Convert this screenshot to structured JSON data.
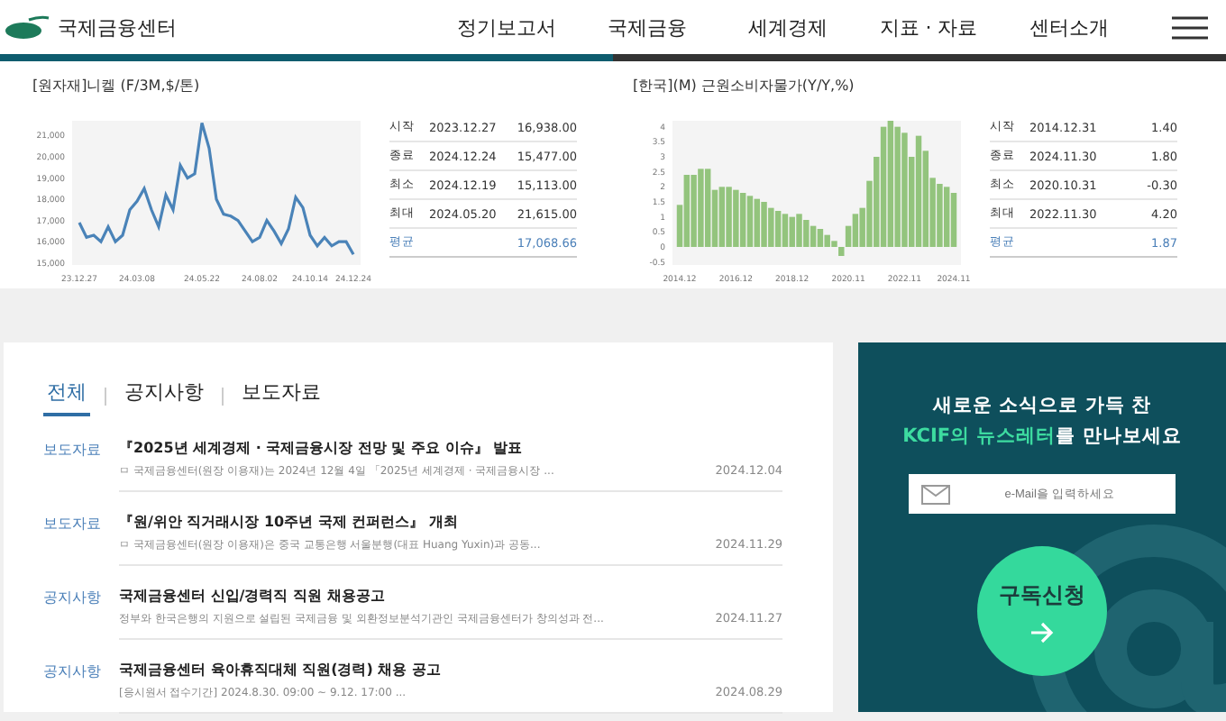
{
  "header": {
    "logo_text": "국제금융센터",
    "nav": [
      "정기보고서",
      "국제금융",
      "세계경제",
      "지표 · 자료",
      "센터소개"
    ]
  },
  "indicators": [
    {
      "title": "[원자재]니켈 (F/3M,$/톤)",
      "chart_data": {
        "type": "line",
        "categories": [
          "23.12.27",
          null,
          null,
          null,
          null,
          null,
          null,
          null,
          "24.03.08",
          null,
          null,
          null,
          null,
          null,
          null,
          null,
          null,
          "24.05.22",
          null,
          null,
          null,
          null,
          null,
          null,
          null,
          "24.08.02",
          null,
          null,
          null,
          null,
          null,
          null,
          "24.10.14",
          null,
          null,
          null,
          null,
          null,
          "24.12.24"
        ],
        "series": [
          {
            "color": "#4a83b8",
            "values": [
              16900,
              16200,
              16300,
              16000,
              16700,
              16000,
              16300,
              17500,
              17900,
              18500,
              17500,
              16700,
              18200,
              17500,
              19600,
              19000,
              19200,
              21600,
              20400,
              18000,
              17300,
              17200,
              17000,
              16500,
              16000,
              16200,
              17000,
              16500,
              15900,
              16600,
              18100,
              17600,
              16300,
              15800,
              16200,
              15800,
              16000,
              16000,
              15400
            ]
          }
        ],
        "ylim": [
          14900,
          21700
        ],
        "yticks": [
          {
            "value": 15000,
            "label": "15,000"
          },
          {
            "value": 16000,
            "label": "16,000"
          },
          {
            "value": 17000,
            "label": "17,000"
          },
          {
            "value": 18000,
            "label": "18,000"
          },
          {
            "value": 19000,
            "label": "19,000"
          },
          {
            "value": 20000,
            "label": "20,000"
          },
          {
            "value": 21000,
            "label": "21,000"
          }
        ]
      },
      "stats": [
        {
          "label": "시작",
          "date": "2023.12.27",
          "value": "16,938.00"
        },
        {
          "label": "종료",
          "date": "2024.12.24",
          "value": "15,477.00"
        },
        {
          "label": "최소",
          "date": "2024.12.19",
          "value": "15,113.00"
        },
        {
          "label": "최대",
          "date": "2024.05.20",
          "value": "21,615.00"
        }
      ],
      "average": {
        "label": "평균",
        "value": "17,068.66"
      }
    },
    {
      "title": "[한국](M) 근원소비자물가(Y/Y,%)",
      "chart_data": {
        "type": "bar",
        "categories": [
          "2014.12",
          null,
          null,
          null,
          null,
          null,
          null,
          null,
          "2016.12",
          null,
          null,
          null,
          null,
          null,
          null,
          null,
          "2018.12",
          null,
          null,
          null,
          null,
          null,
          null,
          null,
          "2020.11",
          null,
          null,
          null,
          null,
          null,
          null,
          null,
          "2022.11",
          null,
          null,
          null,
          null,
          null,
          null,
          "2024.11"
        ],
        "series": [
          {
            "color": "#93c47d",
            "values": [
              1.4,
              2.4,
              2.4,
              2.6,
              2.6,
              1.9,
              2.0,
              2.0,
              1.9,
              1.8,
              1.7,
              1.6,
              1.5,
              1.3,
              1.2,
              1.1,
              1.0,
              1.1,
              0.9,
              0.7,
              0.6,
              0.4,
              0.2,
              -0.3,
              0.7,
              1.1,
              1.3,
              2.2,
              3.0,
              4.0,
              4.2,
              4.0,
              3.8,
              3.0,
              3.7,
              3.2,
              2.3,
              2.1,
              2.0,
              1.8
            ]
          }
        ],
        "ylim": [
          -0.6,
          4.2
        ],
        "yticks": [
          {
            "value": -0.5,
            "label": "-0.5"
          },
          0,
          0.5,
          1,
          1.5,
          2,
          2.5,
          3,
          3.5,
          4
        ]
      },
      "stats": [
        {
          "label": "시작",
          "date": "2014.12.31",
          "value": "1.40"
        },
        {
          "label": "종료",
          "date": "2024.11.30",
          "value": "1.80"
        },
        {
          "label": "최소",
          "date": "2020.10.31",
          "value": "-0.30"
        },
        {
          "label": "최대",
          "date": "2022.11.30",
          "value": "4.20"
        }
      ],
      "average": {
        "label": "평균",
        "value": "1.87"
      }
    }
  ],
  "news": {
    "tabs": [
      {
        "label": "전체",
        "selected": true
      },
      {
        "label": "공지사항",
        "selected": false
      },
      {
        "label": "보도자료",
        "selected": false
      }
    ],
    "items": [
      {
        "category": "보도자료",
        "title": "『2025년 세계경제 · 국제금융시장 전망 및 주요 이슈』 발표",
        "summary": "ㅁ 국제금융센터(원장 이용재)는 2024년 12월 4일 「2025년 세계경제 · 국제금융시장 ...",
        "date": "2024.12.04"
      },
      {
        "category": "보도자료",
        "title": "『원/위안 직거래시장 10주년 국제 컨퍼런스』 개최",
        "summary": "ㅁ 국제금융센터(원장 이용재)은 중국 교통은행 서울분행(대표 Huang Yuxin)과 공동...",
        "date": "2024.11.29"
      },
      {
        "category": "공지사항",
        "title": "국제금융센터 신입/경력직 직원 채용공고",
        "summary": "정부와 한국은행의 지원으로 설립된 국제금융 및 외환정보분석기관인 국제금융센터가 창의성과 전...",
        "date": "2024.11.27"
      },
      {
        "category": "공지사항",
        "title": "국제금융센터 육아휴직대체 직원(경력) 채용 공고",
        "summary": "[응시원서 접수기간] 2024.8.30. 09:00 ~ 9.12. 17:00 ...",
        "date": "2024.08.29"
      }
    ]
  },
  "newsletter": {
    "headline": "새로운 소식으로 가득 찬",
    "headline_2": {
      "highlight": "KCIF의 뉴스레터",
      "rest": "를 만나보세요"
    },
    "email": {
      "placeholder": "e-Mail을 입력하세요"
    },
    "subscribe_button": "구독신청"
  }
}
